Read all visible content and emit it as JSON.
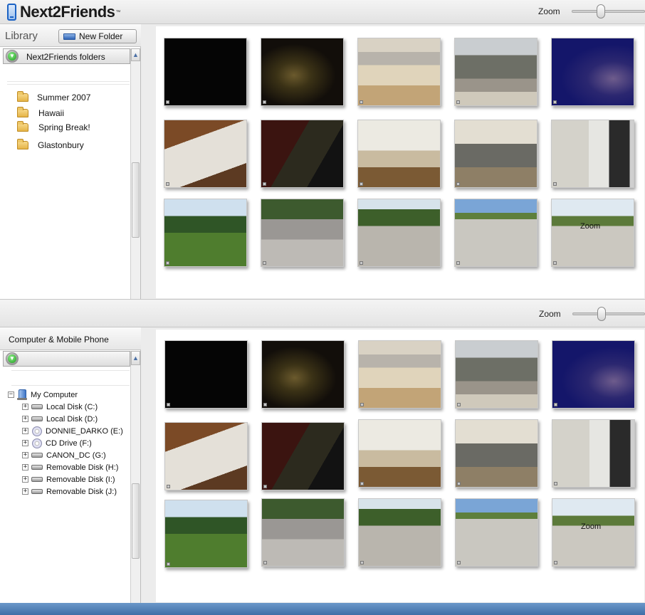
{
  "app": {
    "brand": "Next2Friends",
    "trademark": "™"
  },
  "top_panel": {
    "zoom_label": "Zoom",
    "zoom_value": 0.35,
    "library_title": "Library",
    "new_folder_label": "New Folder",
    "folders_bar_label": "Next2Friends folders",
    "folders": [
      {
        "name": "Summer 2007"
      },
      {
        "name": "Hawaii"
      },
      {
        "name": "Spring Break!"
      },
      {
        "name": "Glastonbury"
      }
    ],
    "thumb_overlay_text": "Zoom"
  },
  "bottom_panel": {
    "zoom_label": "Zoom",
    "zoom_value": 0.35,
    "title": "Computer & Mobile Phone",
    "tree_root": "My Computer",
    "drives": [
      {
        "label": "Local Disk (C:)",
        "icon": "hard-drive-icon"
      },
      {
        "label": "Local Disk (D:)",
        "icon": "hard-drive-icon"
      },
      {
        "label": "DONNIE_DARKO (E:)",
        "icon": "cd-icon"
      },
      {
        "label": "CD Drive (F:)",
        "icon": "cd-icon"
      },
      {
        "label": "CANON_DC (G:)",
        "icon": "hard-drive-icon"
      },
      {
        "label": "Removable Disk (H:)",
        "icon": "hard-drive-icon"
      },
      {
        "label": "Removable Disk (I:)",
        "icon": "hard-drive-icon"
      },
      {
        "label": "Removable Disk (J:)",
        "icon": "hard-drive-icon"
      }
    ],
    "thumb_overlay_text": "Zoom"
  },
  "colors": {
    "brand_blue": "#1b62c4",
    "panel_bg": "#ececec",
    "taskbar": "#4a7bb5"
  }
}
